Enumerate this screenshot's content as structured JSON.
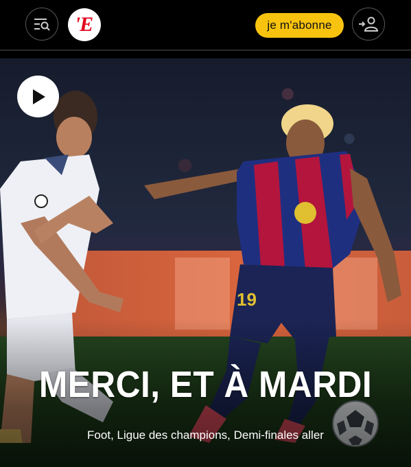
{
  "header": {
    "logo_text": "'E",
    "subscribe_label": "je m'abonne"
  },
  "article": {
    "headline": "MERCI, ET À MARDI",
    "category": "Foot, Ligue des champions, Demi-finales aller"
  },
  "colors": {
    "brand_red": "#e3001b",
    "subscribe_yellow": "#f7c30f"
  }
}
